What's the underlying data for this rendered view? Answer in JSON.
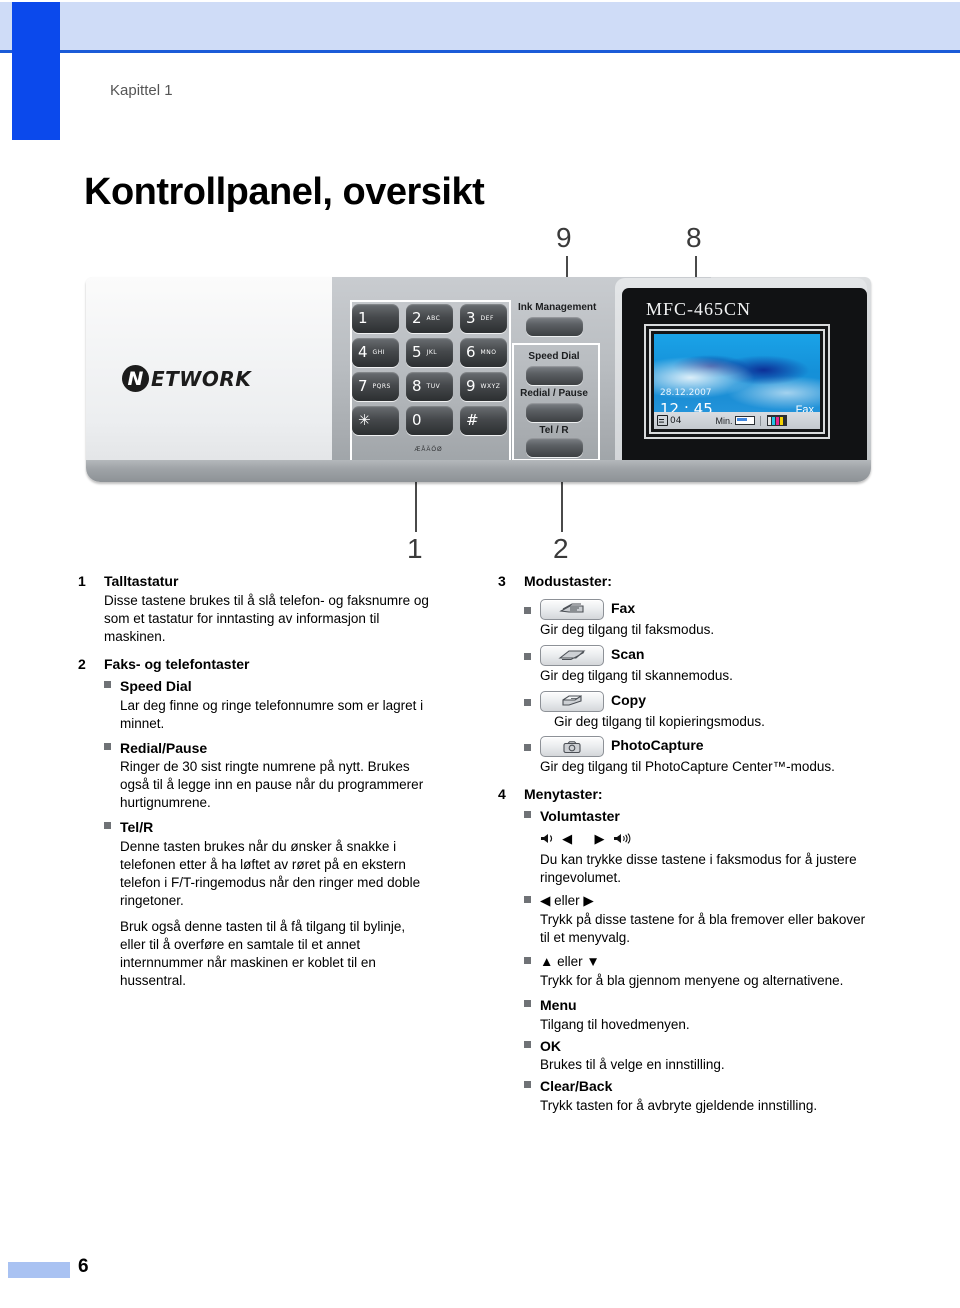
{
  "page": {
    "chapter": "Kapittel 1",
    "title": "Kontrollpanel, oversikt",
    "folio": "6"
  },
  "figure": {
    "callouts": [
      "9",
      "8",
      "1",
      "2"
    ],
    "logo": {
      "mark": "N",
      "text": "ETWORK"
    },
    "keypad": {
      "keys": [
        {
          "digit": "1",
          "letters": ""
        },
        {
          "digit": "2",
          "letters": "ABC"
        },
        {
          "digit": "3",
          "letters": "DEF"
        },
        {
          "digit": "4",
          "letters": "GHI"
        },
        {
          "digit": "5",
          "letters": "JKL"
        },
        {
          "digit": "6",
          "letters": "MNO"
        },
        {
          "digit": "7",
          "letters": "PQRS"
        },
        {
          "digit": "8",
          "letters": "TUV"
        },
        {
          "digit": "9",
          "letters": "WXYZ"
        },
        {
          "digit": "✳",
          "letters": ""
        },
        {
          "digit": "0",
          "letters": ""
        },
        {
          "digit": "#",
          "letters": ""
        }
      ],
      "footer": "ÆÅÄÖØ"
    },
    "buttons": {
      "ink_management": "Ink Management",
      "speed_dial": "Speed Dial",
      "redial_pause": "Redial / Pause",
      "tel_r": "Tel / R"
    },
    "lcd": {
      "model": "MFC-465CN",
      "date": "28.12.2007",
      "time": "12 : 45",
      "mode": "Fax",
      "doc_count": "04",
      "min_label": "Min."
    }
  },
  "left_column": {
    "item1": {
      "num": "1",
      "title": "Talltastatur",
      "body": "Disse tastene brukes til å slå telefon- og faksnumre og som et tastatur for inntasting av informasjon til maskinen."
    },
    "item2": {
      "num": "2",
      "title": "Faks- og telefontaster",
      "bullets": [
        {
          "label": "Speed Dial",
          "body": "Lar deg finne og ringe telefonnumre som er lagret i minnet."
        },
        {
          "label": "Redial/Pause",
          "body": "Ringer de 30 sist ringte numrene på nytt. Brukes også til å legge inn en pause når du programmerer hurtignumrene."
        },
        {
          "label": "Tel/R",
          "body": "Denne tasten brukes når du ønsker å snakke i telefonen etter å ha løftet av røret på en ekstern telefon i F/T-ringemodus når den ringer med doble ringetoner.",
          "body2": "Bruk også denne tasten til å få tilgang til bylinje, eller til å overføre en samtale til et annet internnummer når maskinen er koblet til en hussentral."
        }
      ]
    }
  },
  "right_column": {
    "item3": {
      "num": "3",
      "title": "Modustaster:",
      "bullets": [
        {
          "icon": "fax-icon",
          "label": "Fax",
          "body": "Gir deg tilgang til faksmodus."
        },
        {
          "icon": "scan-icon",
          "label": "Scan",
          "body": "Gir deg tilgang til skannemodus."
        },
        {
          "icon": "copy-icon",
          "label": "Copy",
          "body": "Gir deg tilgang til kopieringsmodus."
        },
        {
          "icon": "photocapture-icon",
          "label": "PhotoCapture",
          "body": "Gir deg tilgang til PhotoCapture Center™-modus."
        }
      ]
    },
    "item4": {
      "num": "4",
      "title": "Menytaster:",
      "bullets": [
        {
          "label": "Volumtaster",
          "glyphs": "🔈 ◀   ▶ 🔊",
          "body": "Du kan trykke disse tastene i faksmodus for å justere ringevolumet."
        },
        {
          "label": "◀ eller ▶",
          "body": "Trykk på disse tastene for å bla fremover eller bakover til et menyvalg."
        },
        {
          "label": "▲ eller ▼",
          "body": "Trykk for å bla gjennom menyene og alternativene."
        },
        {
          "label": "Menu",
          "body": "Tilgang til hovedmenyen."
        },
        {
          "label": "OK",
          "body": "Brukes til å velge en innstilling."
        },
        {
          "label": "Clear/Back",
          "body": "Trykk tasten for å avbryte gjeldende innstilling."
        }
      ]
    }
  }
}
